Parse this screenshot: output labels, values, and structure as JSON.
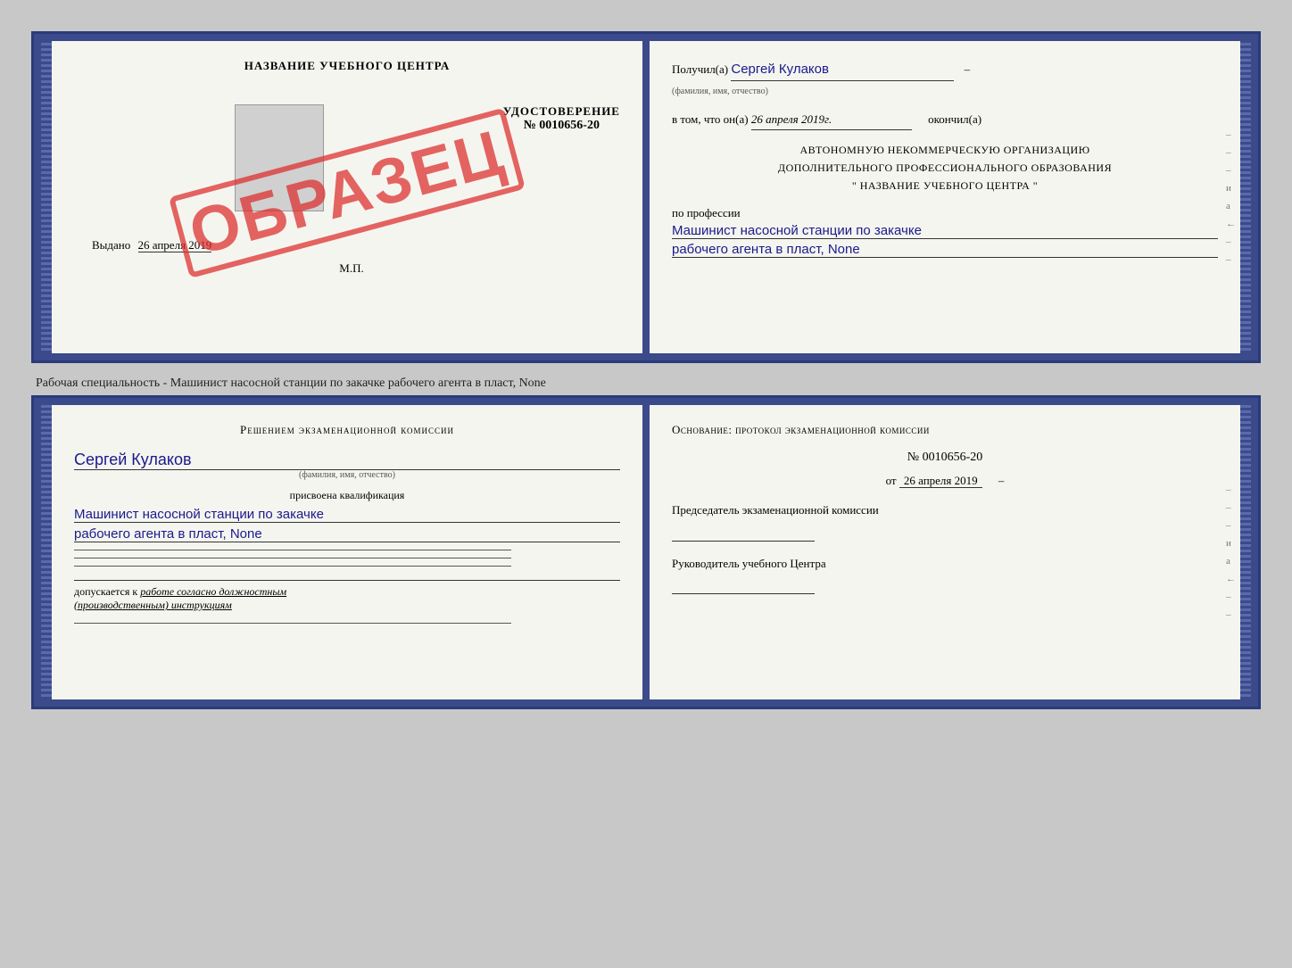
{
  "top_certificate": {
    "left_page": {
      "title": "НАЗВАНИЕ УЧЕБНОГО ЦЕНТРА",
      "udostoverenie_label": "УДОСТОВЕРЕНИЕ",
      "number": "№ 0010656-20",
      "vydano_prefix": "Выдано",
      "vydano_date": "26 апреля 2019",
      "mp_label": "М.П.",
      "stamp": "ОБРАЗЕЦ"
    },
    "right_page": {
      "poluchil_prefix": "Получил(а)",
      "poluchil_name": "Сергей Кулаков",
      "familiya_label": "(фамилия, имя, отчество)",
      "vtom_prefix": "в том, что он(а)",
      "vtom_date": "26 апреля 2019г.",
      "okoncil_suffix": "окончил(а)",
      "org_line1": "АВТОНОМНУЮ НЕКОММЕРЧЕСКУЮ ОРГАНИЗАЦИЮ",
      "org_line2": "ДОПОЛНИТЕЛЬНОГО ПРОФЕССИОНАЛЬНОГО ОБРАЗОВАНИЯ",
      "org_line3": "\"  НАЗВАНИЕ УЧЕБНОГО ЦЕНТРА  \"",
      "po_professii": "по профессии",
      "profession_line1": "Машинист насосной станции по закачке",
      "profession_line2": "рабочего агента в пласт, None",
      "dash1": "–",
      "dash2": "–",
      "dash3": "–",
      "dash4": "–",
      "i_mark": "и",
      "a_mark": "а",
      "arrow_mark": "←"
    }
  },
  "subtitle": "Рабочая специальность - Машинист насосной станции по закачке рабочего агента в пласт,\nNone",
  "bottom_certificate": {
    "left_page": {
      "decision_text": "Решением  экзаменационной  комиссии",
      "name": "Сергей Кулаков",
      "familiya_label": "(фамилия, имя, отчество)",
      "prisvoena_text": "присвоена квалификация",
      "profession_line1": "Машинист насосной станции по закачке",
      "profession_line2": "рабочего агента в пласт, None",
      "line1": "",
      "line2": "",
      "line3": "",
      "dopuskaetsya_prefix": "допускается к",
      "dopuskaetsya_text": "работе согласно должностным\n(производственным) инструкциям",
      "bottom_line": ""
    },
    "right_page": {
      "osnovanie_text": "Основание:  протокол  экзаменационной  комиссии",
      "protocol_num": "№  0010656-20",
      "protocol_date_prefix": "от",
      "protocol_date": "26 апреля 2019",
      "predsedatel_label": "Председатель экзаменационной\nкомиссии",
      "rukovoditel_label": "Руководитель учебного\nЦентра",
      "dash1": "–",
      "dash2": "–",
      "dash3": "–",
      "i_mark": "и",
      "a_mark": "а",
      "arrow_mark": "←"
    }
  }
}
